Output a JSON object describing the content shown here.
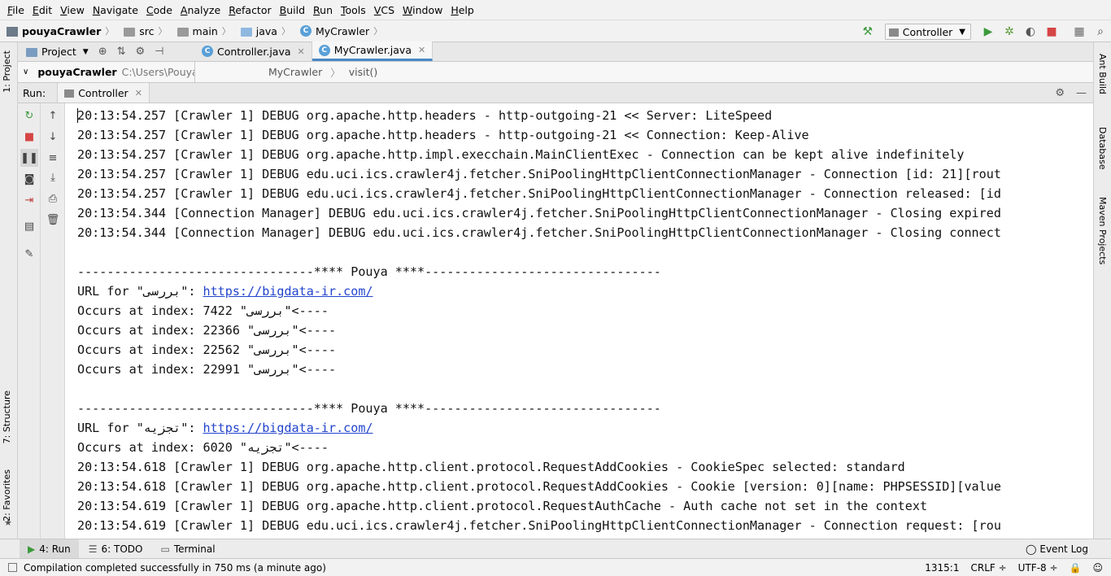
{
  "menu": [
    "File",
    "Edit",
    "View",
    "Navigate",
    "Code",
    "Analyze",
    "Refactor",
    "Build",
    "Run",
    "Tools",
    "VCS",
    "Window",
    "Help"
  ],
  "breadcrumb": [
    "pouyaCrawler",
    "src",
    "main",
    "java",
    "MyCrawler"
  ],
  "run_config": "Controller",
  "project_panel": {
    "label": "Project",
    "root": "pouyaCrawler",
    "path": "C:\\Users\\Pouya\\D"
  },
  "editor_tabs": [
    {
      "label": "Controller.java",
      "active": false
    },
    {
      "label": "MyCrawler.java",
      "active": true
    }
  ],
  "editor_breadcrumb": [
    "MyCrawler",
    "visit()"
  ],
  "run_panel": {
    "label": "Run:",
    "tab": "Controller"
  },
  "console": [
    "20:13:54.257 [Crawler 1] DEBUG org.apache.http.headers - http-outgoing-21 << Server: LiteSpeed",
    "20:13:54.257 [Crawler 1] DEBUG org.apache.http.headers - http-outgoing-21 << Connection: Keep-Alive",
    "20:13:54.257 [Crawler 1] DEBUG org.apache.http.impl.execchain.MainClientExec - Connection can be kept alive indefinitely",
    "20:13:54.257 [Crawler 1] DEBUG edu.uci.ics.crawler4j.fetcher.SniPoolingHttpClientConnectionManager - Connection [id: 21][rout",
    "20:13:54.257 [Crawler 1] DEBUG edu.uci.ics.crawler4j.fetcher.SniPoolingHttpClientConnectionManager - Connection released: [id",
    "20:13:54.344 [Connection Manager] DEBUG edu.uci.ics.crawler4j.fetcher.SniPoolingHttpClientConnectionManager - Closing expired",
    "20:13:54.344 [Connection Manager] DEBUG edu.uci.ics.crawler4j.fetcher.SniPoolingHttpClientConnectionManager - Closing connect",
    "",
    "--------------------------------**** Pouya ****--------------------------------",
    "URL for \"بررسی\": ",
    "Occurs at index: 7422 \"بررسی\"<----",
    "Occurs at index: 22366 \"بررسی\"<----",
    "Occurs at index: 22562 \"بررسی\"<----",
    "Occurs at index: 22991 \"بررسی\"<----",
    "",
    "--------------------------------**** Pouya ****--------------------------------",
    "URL for \"تجزیه\": ",
    "Occurs at index: 6020 \"تجزیه\"<----",
    "20:13:54.618 [Crawler 1] DEBUG org.apache.http.client.protocol.RequestAddCookies - CookieSpec selected: standard",
    "20:13:54.618 [Crawler 1] DEBUG org.apache.http.client.protocol.RequestAddCookies - Cookie [version: 0][name: PHPSESSID][value",
    "20:13:54.619 [Crawler 1] DEBUG org.apache.http.client.protocol.RequestAuthCache - Auth cache not set in the context",
    "20:13:54.619 [Crawler 1] DEBUG edu.uci.ics.crawler4j.fetcher.SniPoolingHttpClientConnectionManager - Connection request: [rou"
  ],
  "links": {
    "line9": "https://bigdata-ir.com/",
    "line16": "https://bigdata-ir.com/"
  },
  "bottom_tabs": [
    "4: Run",
    "6: TODO",
    "Terminal"
  ],
  "event_log": "Event Log",
  "left_tabs": [
    "1: Project",
    "7: Structure",
    "2: Favorites"
  ],
  "right_tabs": [
    "Ant Build",
    "Database",
    "Maven Projects"
  ],
  "status": {
    "message": "Compilation completed successfully in 750 ms (a minute ago)",
    "position": "1315:1",
    "line_sep": "CRLF ÷",
    "encoding": "UTF-8 ÷"
  },
  "colors": {
    "link": "#2244cc",
    "accent": "#4a88c7",
    "run_green": "#3b9a3b",
    "stop_red": "#d64545"
  }
}
